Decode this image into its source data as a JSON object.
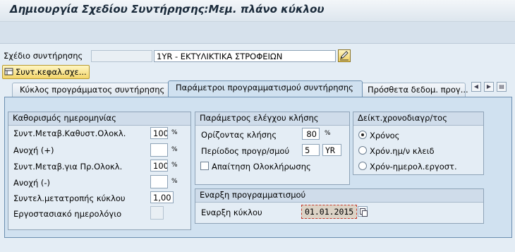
{
  "window": {
    "title": "Δημιουργία Σχεδίου Συντήρησης:Μεμ. πλάνο κύκλου"
  },
  "header": {
    "plan_label": "Σχέδιο συντήρησης",
    "plan_number_value": "",
    "plan_text_value": "1YR - ΕΚΤΥΛΙΚΤΙΚΑ ΣΤΡΟΦΕΙΩΝ",
    "header_button_label": "Συντ.κεφαλ.σχε..."
  },
  "tabs": [
    {
      "label": "Κύκλος προγράμματος συντήρησης",
      "active": false
    },
    {
      "label": "Παράμετροι προγραμματισμού συντήρησης",
      "active": true
    },
    {
      "label": "Πρόσθετα δεδομ. προγ...",
      "active": false
    }
  ],
  "date_determination": {
    "title": "Καθορισμός ημερομηνίας",
    "rows": [
      {
        "label": "Συντ.Μεταβ.Καθυστ.Ολοκλ.",
        "value": "100",
        "unit": "%"
      },
      {
        "label": "Ανοχή (+)",
        "value": "",
        "unit": "%"
      },
      {
        "label": "Συντ.Μεταβ.για Πρ.Ολοκλ.",
        "value": "100",
        "unit": "%"
      },
      {
        "label": "Ανοχή (-)",
        "value": "",
        "unit": "%"
      },
      {
        "label": "Συντελ.μετατροπής κύκλου",
        "value": "1,00",
        "unit": ""
      },
      {
        "label": "Εργοστασιακό ημερολόγιο",
        "value": "",
        "unit": ""
      }
    ]
  },
  "call_control": {
    "title": "Παράμετρος ελέγχου κλήσης",
    "horizon_label": "Ορίζοντας κλήσης",
    "horizon_value": "80",
    "horizon_unit": "%",
    "interval_label": "Περίοδος προγρ/σμού",
    "interval_value": "5",
    "interval_unit": "YR",
    "completion_label": "Απαίτηση Ολοκλήρωσης",
    "completion_checked": false
  },
  "scheduling_indicator": {
    "title": "Δείκτ.χρονοδιαγρ/τος",
    "options": [
      {
        "label": "Χρόνος",
        "selected": true
      },
      {
        "label": "Χρόν.ημ/ν κλειδ",
        "selected": false
      },
      {
        "label": "Χρόν-ημερολ.εργοστ.",
        "selected": false
      }
    ]
  },
  "start_scheduling": {
    "title": "Εναρξη προγραμματισμού",
    "cycle_start_label": "Εναρξη κύκλου",
    "cycle_start_value": "01.01.2015"
  }
}
